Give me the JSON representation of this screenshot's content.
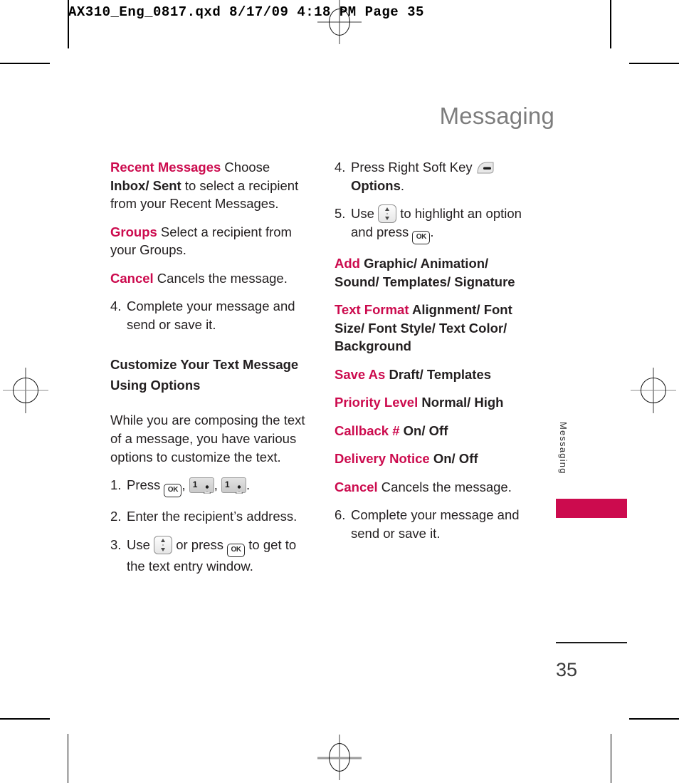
{
  "prepress": {
    "slug": "AX310_Eng_0817.qxd  8/17/09  4:18 PM  Page 35"
  },
  "page": {
    "chapter_title": "Messaging",
    "side_tab_label": "Messaging",
    "folio": "35",
    "accent_color": "#cc0b4e",
    "title_color": "#7d7d7d"
  },
  "left_column": {
    "recent_messages": {
      "term": "Recent Messages",
      "text_1": " Choose ",
      "bold": "Inbox/ Sent",
      "text_2": " to select a recipient from your Recent Messages."
    },
    "groups": {
      "term": "Groups",
      "text": " Select a recipient from your Groups."
    },
    "cancel": {
      "term": "Cancel",
      "text": "  Cancels the message."
    },
    "step_4": {
      "number": "4.",
      "text": "Complete your message and send or save it."
    },
    "section_heading_line_1": "Customize Your Text Message",
    "section_heading_line_2": "Using Options",
    "intro": "While you are composing the text of a message, you have various options to customize the text.",
    "step_1": {
      "number": "1.",
      "text_before": "Press ",
      "sep_1": ",",
      "sep_2": ",",
      "end": "."
    },
    "step_2": {
      "number": "2.",
      "text": "Enter the recipient’s address."
    },
    "step_3": {
      "number": "3.",
      "text_before": "Use ",
      "text_middle": " or press ",
      "text_after": " to get to the text entry window."
    }
  },
  "right_column": {
    "step_4": {
      "number": "4.",
      "text_before": "Press Right Soft Key ",
      "bold": "Options",
      "text_after": "."
    },
    "step_5": {
      "number": "5.",
      "text_before": "Use ",
      "text_middle": " to highlight an option and press ",
      "text_after": "."
    },
    "options": [
      {
        "term": "Add",
        "values": " Graphic/ Animation/ Sound/ Templates/ Signature",
        "bold_values": true
      },
      {
        "term": "Text Format",
        "values": " Alignment/ Font Size/ Font Style/ Text Color/ Background",
        "bold_values": true
      },
      {
        "term": "Save As",
        "values": " Draft/ Templates",
        "bold_values": true
      },
      {
        "term": "Priority Level",
        "values": " Normal/ High",
        "bold_values": true
      },
      {
        "term": "Callback #",
        "values": " On/ Off",
        "bold_values": true
      },
      {
        "term": "Delivery Notice",
        "values": " On/ Off",
        "bold_values": true
      },
      {
        "term": "Cancel",
        "values": " Cancels the message.",
        "bold_values": false
      }
    ],
    "step_6": {
      "number": "6.",
      "text": "Complete your message and send or save it."
    }
  },
  "icons": {
    "ok_key": "OK",
    "num_key": "1",
    "nav_key": "navigation-up-down-key",
    "soft_key": "right-soft-key"
  }
}
